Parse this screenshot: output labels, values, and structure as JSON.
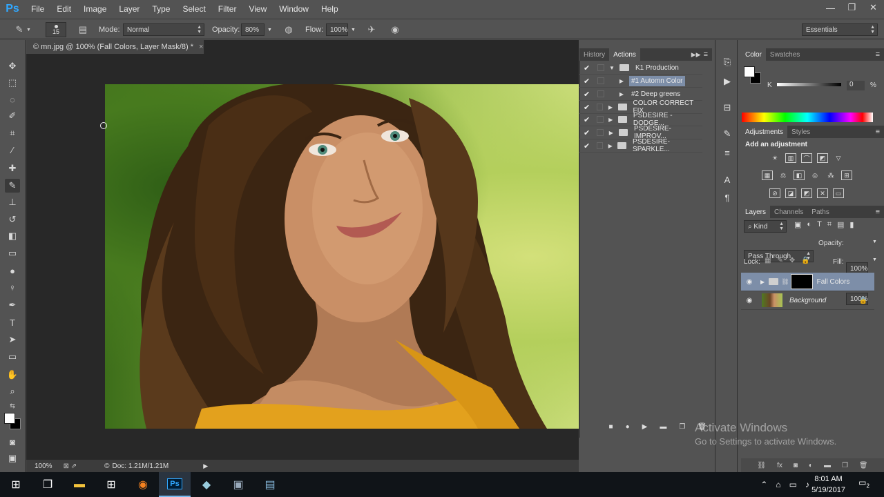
{
  "app": {
    "logo": "Ps"
  },
  "menu": [
    "File",
    "Edit",
    "Image",
    "Layer",
    "Type",
    "Select",
    "Filter",
    "View",
    "Window",
    "Help"
  ],
  "window_controls": {
    "minimize": "—",
    "restore": "❐",
    "close": "✕"
  },
  "options": {
    "brush_size": "15",
    "mode_label": "Mode:",
    "mode_value": "Normal",
    "opacity_label": "Opacity:",
    "opacity_value": "80%",
    "flow_label": "Flow:",
    "flow_value": "100%",
    "workspace": "Essentials"
  },
  "document": {
    "tab_title": "© mn.jpg @ 100% (Fall Colors, Layer Mask/8) *",
    "zoom": "100%",
    "doc_size": "Doc: 1.21M/1.21M"
  },
  "actions_panel": {
    "tabs": [
      "History",
      "Actions"
    ],
    "active_tab": "Actions",
    "rows": [
      {
        "label": "K1 Production",
        "level": 0,
        "checked": true,
        "expanded": true,
        "folder": true,
        "selected": false
      },
      {
        "label": "#1 Automn Color",
        "level": 1,
        "checked": true,
        "expanded": false,
        "folder": false,
        "selected": true
      },
      {
        "label": "#2 Deep greens",
        "level": 1,
        "checked": true,
        "expanded": false,
        "folder": false,
        "selected": false
      },
      {
        "label": "COLOR CORRECT FIX",
        "level": 0,
        "checked": true,
        "expanded": false,
        "folder": true,
        "selected": false
      },
      {
        "label": "PSDESIRE - DODGE...",
        "level": 0,
        "checked": true,
        "expanded": false,
        "folder": true,
        "selected": false
      },
      {
        "label": "PSDESIRE-IMPROV...",
        "level": 0,
        "checked": true,
        "expanded": false,
        "folder": true,
        "selected": false
      },
      {
        "label": "PSDESIRE-SPARKLE...",
        "level": 0,
        "checked": true,
        "expanded": false,
        "folder": true,
        "selected": false
      }
    ]
  },
  "color_panel": {
    "tabs": [
      "Color",
      "Swatches"
    ],
    "active_tab": "Color",
    "channel": "K",
    "value": "0",
    "unit": "%",
    "foreground": "#ffffff",
    "background": "#000000"
  },
  "adjustments_panel": {
    "tabs": [
      "Adjustments",
      "Styles"
    ],
    "active_tab": "Adjustments",
    "heading": "Add an adjustment"
  },
  "layers_panel": {
    "tabs": [
      "Layers",
      "Channels",
      "Paths"
    ],
    "active_tab": "Layers",
    "filter_kind": "Kind",
    "blend_mode": "Pass Through",
    "opacity_label": "Opacity:",
    "opacity_value": "100%",
    "lock_label": "Lock:",
    "fill_label": "Fill:",
    "fill_value": "100%",
    "layers": [
      {
        "name": "Fall Colors",
        "type": "group",
        "selected": true
      },
      {
        "name": "Background",
        "type": "image",
        "selected": false
      }
    ]
  },
  "watermark": {
    "title": "Activate Windows",
    "subtitle": "Go to Settings to activate Windows."
  },
  "taskbar": {
    "time": "8:01 AM",
    "date": "5/19/2017",
    "notification_count": "2"
  },
  "colors": {
    "accent_selected": "#7d8ea8",
    "ps_blue": "#31a8ff"
  }
}
